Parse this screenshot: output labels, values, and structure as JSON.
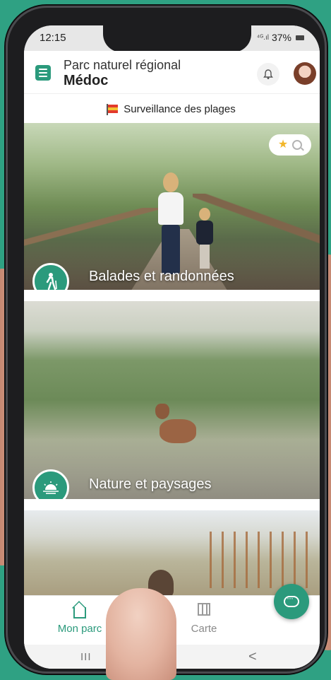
{
  "status_bar": {
    "time": "12:15",
    "signal": "⁴ᴳ.ıl",
    "battery": "37%"
  },
  "header": {
    "subtitle": "Parc naturel régional",
    "title": "Médoc",
    "menu_icon": "hamburger-menu-icon",
    "notifications_icon": "bell-icon",
    "avatar_icon": "user-avatar"
  },
  "banner": {
    "icon": "flag-icon",
    "text": "Surveillance des plages"
  },
  "cards": [
    {
      "label": "Balades et randonnées",
      "icon": "hiker-icon"
    },
    {
      "label": "Nature et paysages",
      "icon": "sunset-icon"
    },
    {
      "label": "",
      "icon": ""
    }
  ],
  "search": {
    "favorite_icon": "star-icon",
    "search_icon": "search-icon"
  },
  "bottom_nav": {
    "items": [
      {
        "label": "Mon parc",
        "icon": "home-icon",
        "active": true
      },
      {
        "label": "Carte",
        "icon": "map-icon",
        "active": false
      }
    ]
  },
  "chat_button": {
    "icon": "chat-icon"
  },
  "system_nav": {
    "recent": "III",
    "back": "<"
  },
  "colors": {
    "accent": "#2b9a7c",
    "background": "#2fa183",
    "favorite": "#f2b62a"
  }
}
